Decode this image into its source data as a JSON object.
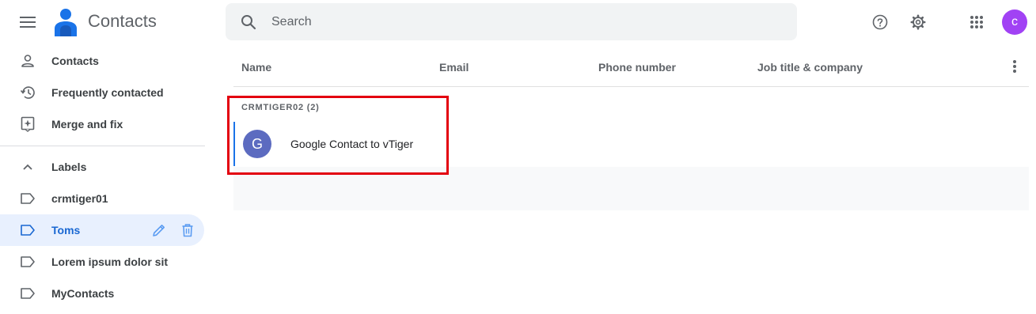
{
  "app": {
    "title": "Contacts"
  },
  "search": {
    "placeholder": "Search"
  },
  "user": {
    "initial": "c",
    "color": "#a142f4"
  },
  "sidebar": {
    "items": [
      {
        "label": "Contacts",
        "icon": "person-icon"
      },
      {
        "label": "Frequently contacted",
        "icon": "history-icon"
      },
      {
        "label": "Merge and fix",
        "icon": "merge-fix-icon"
      }
    ],
    "labels_header": "Labels",
    "labels": [
      {
        "label": "crmtiger01",
        "active": false
      },
      {
        "label": "Toms",
        "active": true
      },
      {
        "label": "Lorem ipsum dolor sit",
        "active": false
      },
      {
        "label": "MyContacts",
        "active": false
      }
    ]
  },
  "table": {
    "columns": [
      "Name",
      "Email",
      "Phone number",
      "Job title & company"
    ],
    "group_label": "CRMTIGER02 (2)",
    "rows": [
      {
        "avatar_initial": "G",
        "avatar_color": "#5c6bc0",
        "name": "Google Contact to vTiger"
      }
    ]
  },
  "colors": {
    "accent": "#1a73e8",
    "active_bg": "#e8f0fe",
    "highlight_box": "#e3000f"
  }
}
